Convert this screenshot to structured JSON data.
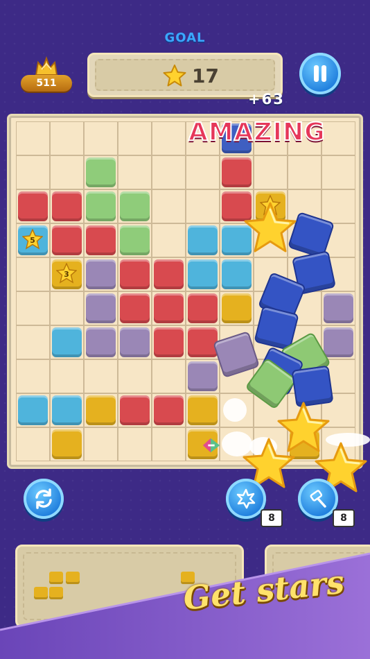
{
  "header": {
    "goal_label": "GOAL",
    "best_score": "511",
    "goal_star_count": "17",
    "score_bonus": "+63"
  },
  "combo_text": "AMAZING",
  "board": {
    "rows": 10,
    "cols": 10,
    "tiles": [
      [
        null,
        null,
        null,
        null,
        null,
        null,
        "navy",
        null,
        null,
        null
      ],
      [
        null,
        null,
        "green",
        null,
        null,
        null,
        "red",
        null,
        null,
        null
      ],
      [
        "red",
        "red",
        "green",
        "green",
        null,
        null,
        "red",
        {
          "color": "yellow",
          "star": ""
        },
        null,
        null
      ],
      [
        {
          "color": "blue",
          "star": "5"
        },
        "red",
        "red",
        "green",
        null,
        "blue",
        "blue",
        null,
        null,
        null
      ],
      [
        null,
        {
          "color": "yellow",
          "star": "3"
        },
        "purple",
        "red",
        "red",
        "blue",
        "blue",
        null,
        null,
        null
      ],
      [
        null,
        null,
        "purple",
        "red",
        "red",
        "red",
        "yellow",
        null,
        null,
        "purple"
      ],
      [
        null,
        "blue",
        "purple",
        "purple",
        "red",
        "red",
        null,
        null,
        null,
        "purple"
      ],
      [
        null,
        null,
        null,
        null,
        null,
        "purple",
        null,
        null,
        null,
        null
      ],
      [
        "blue",
        "blue",
        "yellow",
        "red",
        "red",
        "yellow",
        null,
        null,
        null,
        null
      ],
      [
        null,
        "yellow",
        null,
        null,
        null,
        "yellow",
        null,
        null,
        "yellow",
        null
      ]
    ]
  },
  "powerups": [
    {
      "name": "bomb",
      "count": "8"
    },
    {
      "name": "hammer",
      "count": "8"
    }
  ],
  "banner_text": "Get stars",
  "colors": {
    "background": "#3d2a86",
    "board": "#f7e6c6",
    "red": "#d84a4f",
    "green": "#8fcc7a",
    "blue": "#4fb4dc",
    "purple": "#9a87b6",
    "yellow": "#e5b11f",
    "navy": "#3f5fc1",
    "accent_button": "#1d7cdc",
    "banner": "#8a62c9"
  }
}
